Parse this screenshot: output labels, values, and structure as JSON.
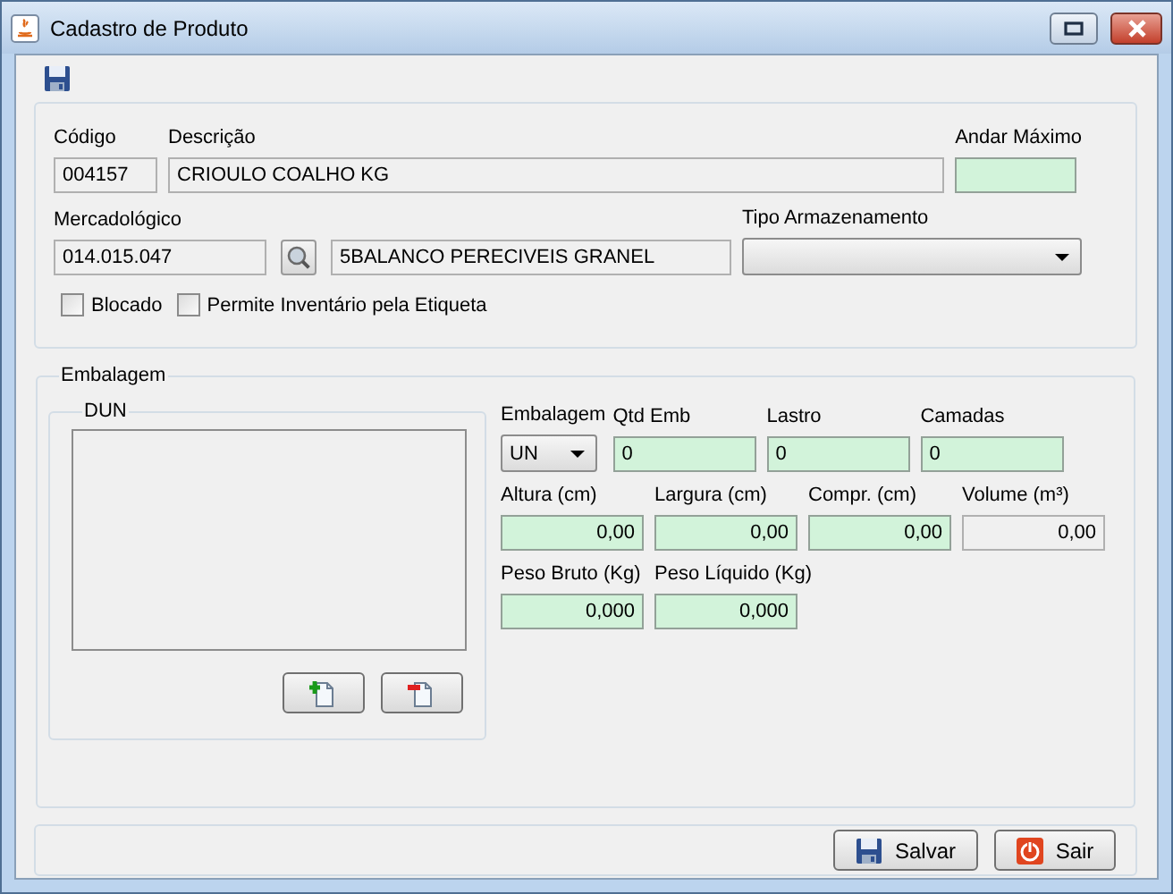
{
  "window": {
    "title": "Cadastro de Produto"
  },
  "product": {
    "fields": [
      {
        "label": "Código",
        "value": "004157",
        "editable": false
      },
      {
        "label": "Descrição",
        "value": "CRIOULO COALHO KG",
        "editable": false
      },
      {
        "label": "Andar Máximo",
        "editable": true
      }
    ],
    "mercadologico": {
      "label": "Mercadológico",
      "code": "014.015.047",
      "name": "5BALANCO PERECIVEIS GRANEL"
    },
    "tipo_armazenamento": {
      "label": "Tipo Armazenamento"
    },
    "checkboxes": [
      {
        "label": "Blocado",
        "checked": false
      },
      {
        "label": "Permite Inventário pela Etiqueta",
        "checked": false
      }
    ]
  },
  "embalagem": {
    "title": "Embalagem",
    "dun": {
      "title": "DUN"
    },
    "unit": {
      "label": "Embalagem",
      "value": "UN"
    },
    "rows": [
      [
        {
          "label": "Qtd Emb",
          "value": "0",
          "editable": true
        },
        {
          "label": "Lastro",
          "value": "0",
          "editable": true
        },
        {
          "label": "Camadas",
          "value": "0",
          "editable": true
        }
      ],
      [
        {
          "label": "Altura (cm)",
          "value": "0,00",
          "editable": true
        },
        {
          "label": "Largura (cm)",
          "value": "0,00",
          "editable": true
        },
        {
          "label": "Compr. (cm)",
          "value": "0,00",
          "editable": true
        },
        {
          "label": "Volume (m³)",
          "value": "0,00",
          "editable": false
        }
      ],
      [
        {
          "label": "Peso Bruto (Kg)",
          "value": "0,000",
          "editable": true
        },
        {
          "label": "Peso Líquido (Kg)",
          "value": "0,000",
          "editable": true
        }
      ]
    ]
  },
  "buttons": [
    {
      "label": "Salvar",
      "kind": "save"
    },
    {
      "label": "Sair",
      "kind": "exit"
    }
  ]
}
